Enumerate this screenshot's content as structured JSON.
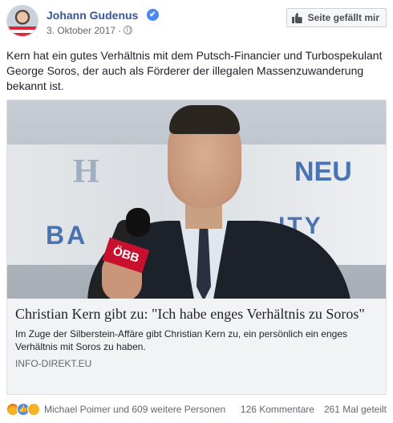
{
  "post": {
    "page_name": "Johann Gudenus",
    "verified_mark": "✔",
    "date": "3. Oktober 2017",
    "separator": "·",
    "like_page_label": "Seite gefällt mir",
    "text": "Kern hat ein gutes Verhältnis mit dem Putsch-Financier und Turbospekulant George Soros, der auch als Förderer der illegalen Massenzuwanderung bekannt ist."
  },
  "link": {
    "image_text": {
      "h": "H",
      "neu": "NEU",
      "ba": "BA",
      "city": "ITY",
      "mic_flag": "ÖBB"
    },
    "title": "Christian Kern gibt zu: \"Ich habe enges Verhältnis zu Soros\"",
    "description": "Im Zuge der Silberstein-Affäre gibt Christian Kern zu, ein persönlich ein enges Verhältnis mit Soros zu haben.",
    "domain": "INFO-DIREKT.EU"
  },
  "footer": {
    "reactions": [
      "angry-icon",
      "like-icon",
      "haha-icon"
    ],
    "reactors": "Michael Poimer und 609 weitere Personen",
    "comments": "126 Kommentare",
    "shares": "261 Mal geteilt"
  },
  "colors": {
    "link_blue": "#365899",
    "meta_gray": "#616770",
    "card_bg": "#f2f3f5"
  }
}
